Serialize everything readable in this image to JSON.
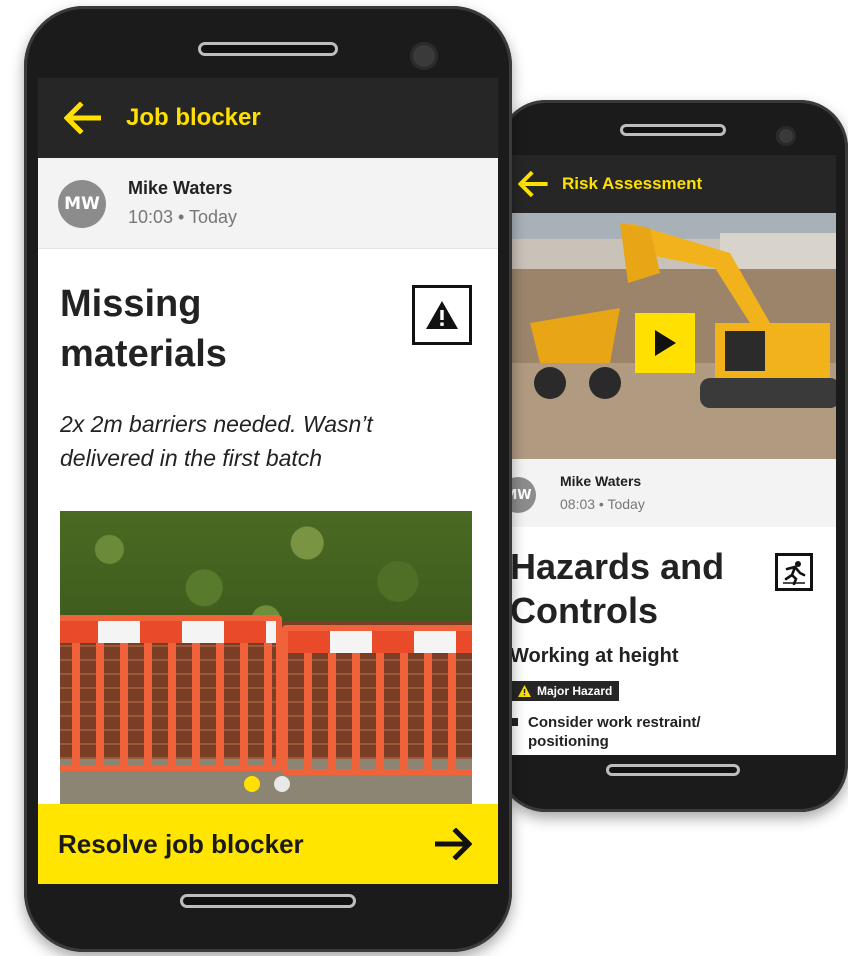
{
  "colors": {
    "accent_yellow": "#ffe000",
    "appbar_dark": "#262626",
    "avatar_gray": "#8c8c8c"
  },
  "phone_front": {
    "appbar": {
      "back_icon": "arrow-left-icon",
      "title": "Job blocker"
    },
    "author": {
      "initials": "MW",
      "name": "Mike Waters",
      "time": "10:03 • Today"
    },
    "post": {
      "title": "Missing materials",
      "hazard_icon": "warning-triangle-icon",
      "description": "2x 2m barriers needed. Wasn’t delivered in the first batch"
    },
    "carousel": {
      "active_index": 0,
      "count": 2
    },
    "cta": {
      "label": "Resolve job blocker",
      "icon": "arrow-right-icon"
    }
  },
  "phone_back": {
    "appbar": {
      "back_icon": "arrow-left-icon",
      "title": "Risk Assessment"
    },
    "video": {
      "play_icon": "play-icon"
    },
    "author": {
      "initials": "MW",
      "name": "Mike Waters",
      "time": "08:03 • Today"
    },
    "assessment": {
      "title": "Hazards and Controls",
      "hazard_icon": "falling-person-icon",
      "subtitle": "Working at height",
      "badge": "Major Hazard",
      "bullets": [
        "Consider work restraint/ positioning"
      ]
    }
  }
}
